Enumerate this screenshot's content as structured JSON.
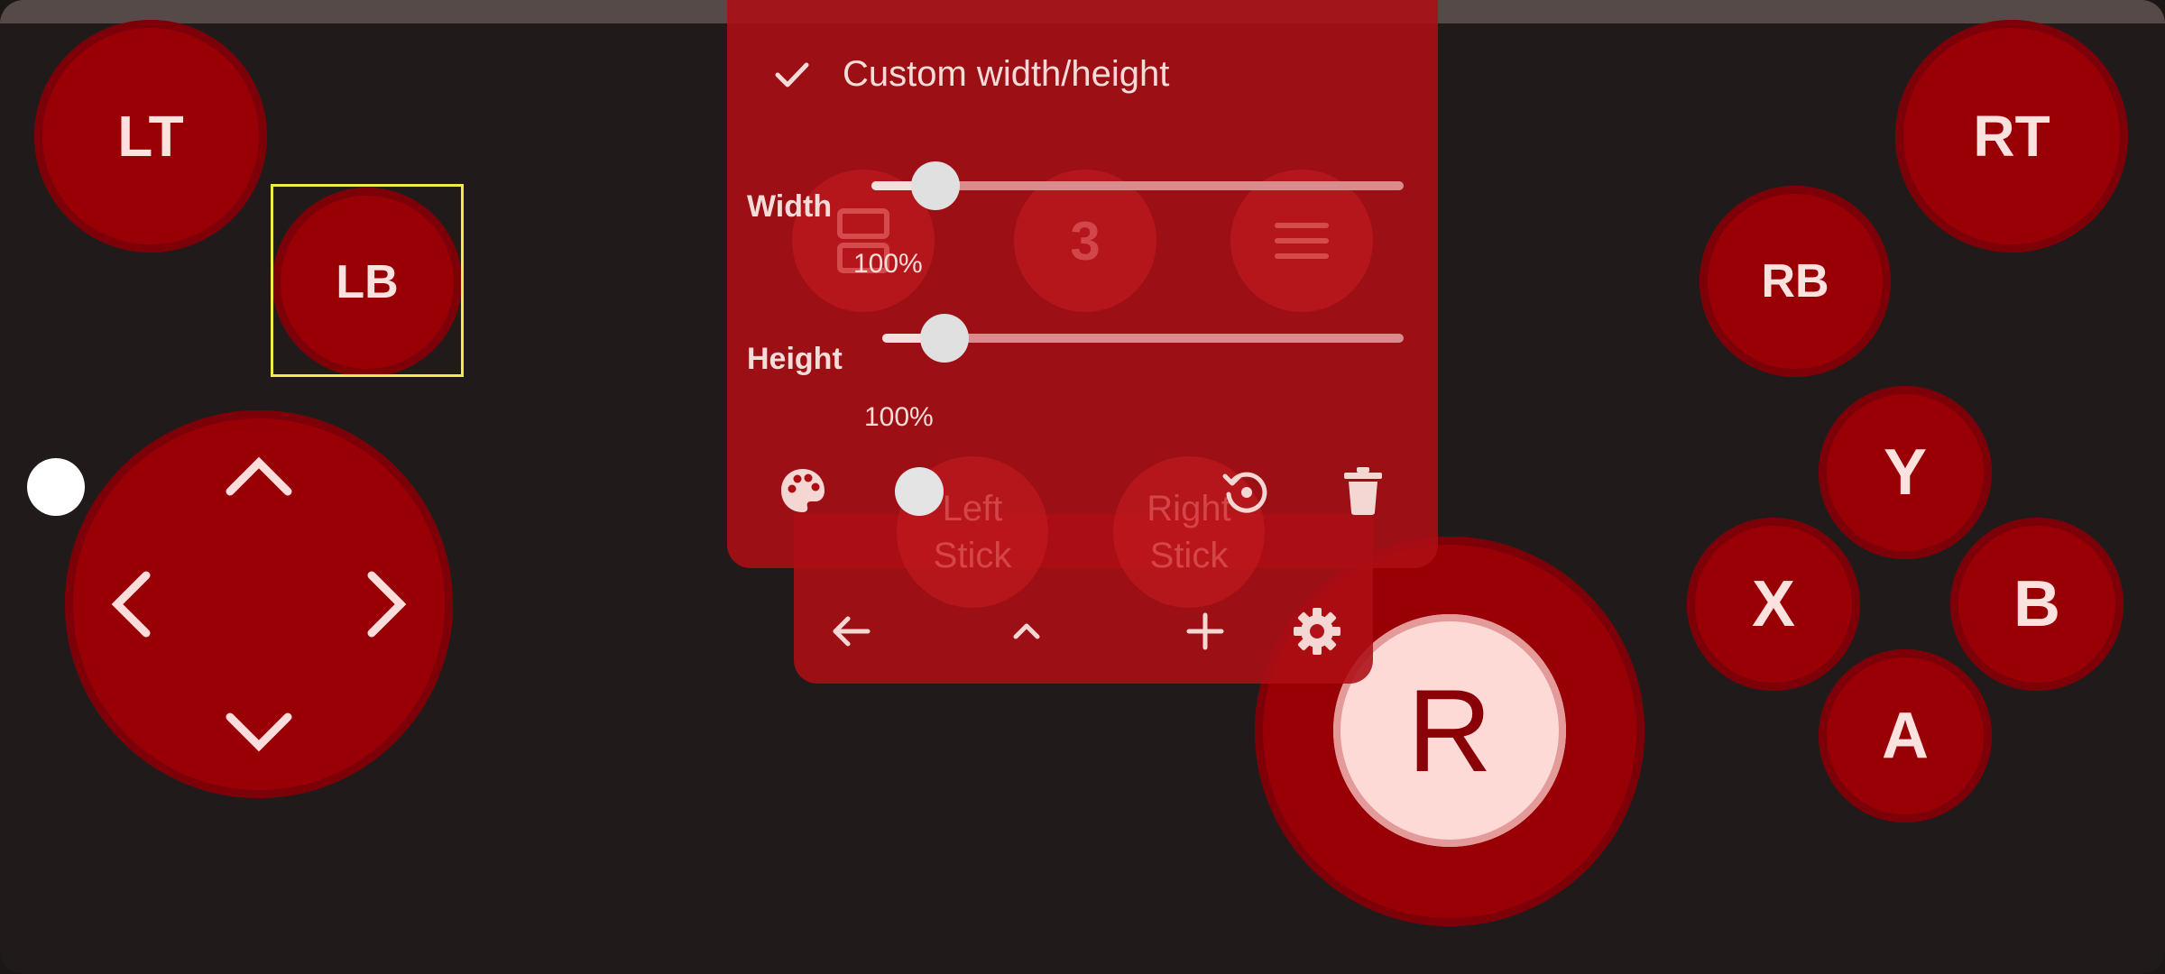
{
  "buttons": {
    "lt": "LT",
    "lb": "LB",
    "rt": "RT",
    "rb": "RB",
    "y": "Y",
    "x": "X",
    "b": "B",
    "a": "A",
    "right_stick_knob": "R"
  },
  "menu": {
    "custom_size_label": "Custom width/height",
    "custom_size_checked": true,
    "width_label": "Width",
    "width_value": "100%",
    "width_level": 0.12,
    "height_label": "Height",
    "height_value": "100%",
    "height_level": 0.12,
    "action_icons": [
      "palette-icon",
      "toggle-dot",
      "reset-icon",
      "delete-icon"
    ],
    "bottom_icons": [
      "back-arrow-icon",
      "chevron-up-icon",
      "add-icon",
      "settings-icon"
    ]
  },
  "ghost_buttons": {
    "count_label": "3",
    "left_stick": "Left\nStick",
    "right_stick": "Right\nStick"
  },
  "colors": {
    "button_red": "#990006",
    "panel_red": "#ac0e14",
    "selection": "#f2e94b",
    "knob": "#fddad6"
  }
}
